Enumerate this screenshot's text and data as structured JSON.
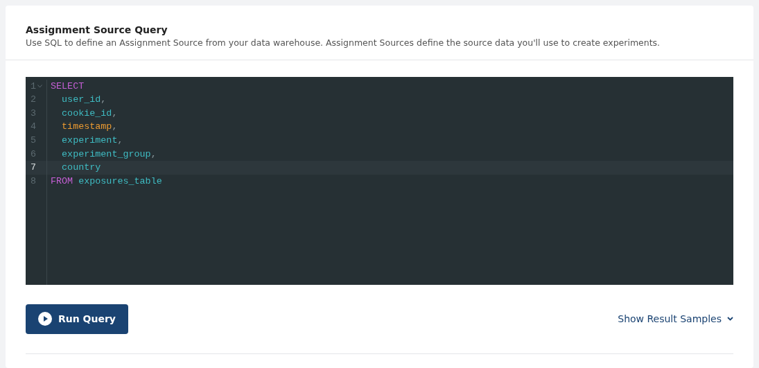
{
  "header": {
    "title": "Assignment Source Query",
    "description": "Use SQL to define an Assignment Source from your data warehouse. Assignment Sources define the source data you'll use to create experiments."
  },
  "editor": {
    "lines": [
      {
        "number": "1",
        "active": false,
        "foldable": true,
        "tokens": [
          {
            "text": "SELECT",
            "kind": "keyword"
          }
        ]
      },
      {
        "number": "2",
        "active": false,
        "foldable": false,
        "tokens": [
          {
            "text": "  user_id",
            "kind": "identifier"
          },
          {
            "text": ",",
            "kind": "punct"
          }
        ]
      },
      {
        "number": "3",
        "active": false,
        "foldable": false,
        "tokens": [
          {
            "text": "  cookie_id",
            "kind": "identifier"
          },
          {
            "text": ",",
            "kind": "punct"
          }
        ]
      },
      {
        "number": "4",
        "active": false,
        "foldable": false,
        "tokens": [
          {
            "text": "  timestamp",
            "kind": "builtin"
          },
          {
            "text": ",",
            "kind": "punct"
          }
        ]
      },
      {
        "number": "5",
        "active": false,
        "foldable": false,
        "tokens": [
          {
            "text": "  experiment",
            "kind": "identifier"
          },
          {
            "text": ",",
            "kind": "punct"
          }
        ]
      },
      {
        "number": "6",
        "active": false,
        "foldable": false,
        "tokens": [
          {
            "text": "  experiment_group",
            "kind": "identifier"
          },
          {
            "text": ",",
            "kind": "punct"
          }
        ]
      },
      {
        "number": "7",
        "active": true,
        "foldable": false,
        "tokens": [
          {
            "text": "  country",
            "kind": "identifier"
          }
        ]
      },
      {
        "number": "8",
        "active": false,
        "foldable": false,
        "tokens": [
          {
            "text": "FROM",
            "kind": "keyword"
          },
          {
            "text": " exposures_table",
            "kind": "identifier"
          }
        ]
      }
    ]
  },
  "run_button": {
    "label": "Run Query"
  },
  "results_toggle": {
    "label": "Show Result Samples",
    "expanded": false
  }
}
